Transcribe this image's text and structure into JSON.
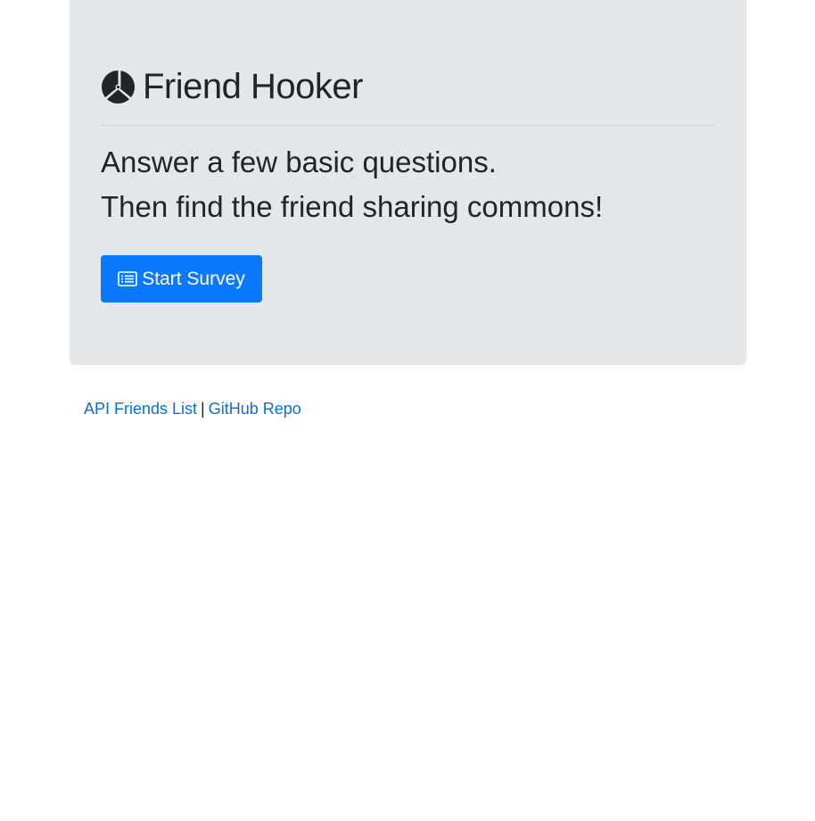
{
  "header": {
    "brand_icon": "pinwheel-icon",
    "title": "Friend Hooker"
  },
  "lead": {
    "line1": "Answer a few basic questions.",
    "line2": "Then find the friend sharing commons!"
  },
  "cta": {
    "icon": "list-icon",
    "label": "Start Survey"
  },
  "footer": {
    "link1": "API Friends List",
    "separator": "|",
    "link2": "GitHub Repo"
  },
  "colors": {
    "jumbotron_bg": "#e4e7ea",
    "primary": "#0a79ff",
    "link": "#0a6fd8",
    "text": "#212529"
  }
}
